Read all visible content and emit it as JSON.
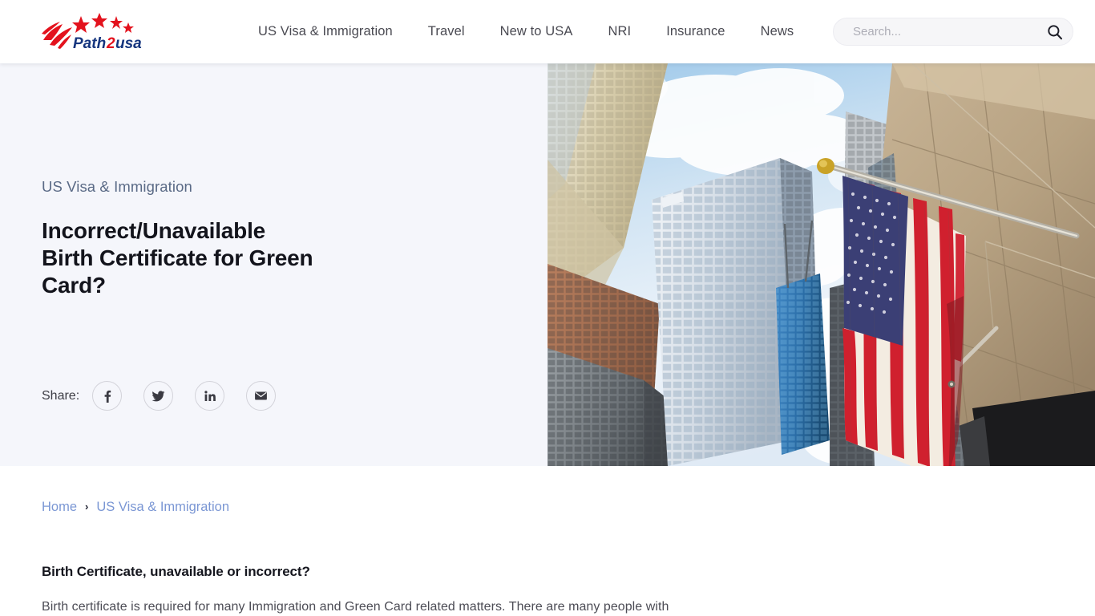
{
  "site": {
    "logo_text_1": "Path",
    "logo_text_2": "2",
    "logo_text_3": "usa",
    "logo_alt": "Path2usa logo"
  },
  "nav": {
    "items": [
      {
        "label": "US Visa & Immigration"
      },
      {
        "label": "Travel"
      },
      {
        "label": "New to USA"
      },
      {
        "label": "NRI"
      },
      {
        "label": "Insurance"
      },
      {
        "label": "News"
      }
    ]
  },
  "search": {
    "value": "",
    "placeholder": "Search...",
    "icon": "search-icon"
  },
  "hero": {
    "category": "US Visa & Immigration",
    "title": "Incorrect/Unavailable Birth Certificate for Green Card?",
    "share_label": "Share:",
    "share_buttons": [
      {
        "name": "facebook",
        "glyph": "f"
      },
      {
        "name": "twitter",
        "glyph": "bird"
      },
      {
        "name": "linkedin",
        "glyph": "in"
      },
      {
        "name": "email",
        "glyph": "envelope"
      }
    ],
    "image_alt": "American flag on a pole against city skyscrapers"
  },
  "breadcrumb": {
    "items": [
      {
        "label": "Home"
      },
      {
        "label": "US Visa & Immigration"
      }
    ],
    "separator": "›"
  },
  "article": {
    "heading": "Birth Certificate, unavailable or incorrect?",
    "paragraph": "Birth certificate is required for many Immigration and Green Card related matters. There are many people with"
  },
  "colors": {
    "hero_bg": "#f5f6fb",
    "category_text": "#5a6a86",
    "title_text": "#13141c",
    "breadcrumb_link": "#7b97d4",
    "logo_navy": "#15357e",
    "logo_red": "#e3121d"
  }
}
